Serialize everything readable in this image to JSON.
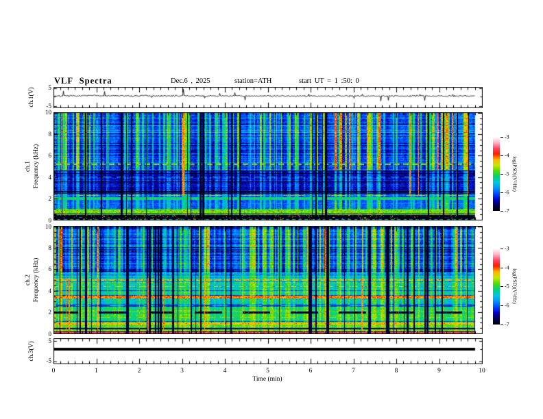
{
  "header": {
    "title": "VLF Spectra",
    "date": "Dec.6 , 2025",
    "station": "station=ATH",
    "start_ut": "start UT =  1 :50: 0"
  },
  "x_axis": {
    "label": "Time (min)",
    "ticks": [
      "0",
      "1",
      "2",
      "3",
      "4",
      "5",
      "6",
      "7",
      "8",
      "9",
      "10"
    ],
    "range_min": [
      0,
      10
    ],
    "minor_tick_step_min": 0.1667
  },
  "panels": {
    "ch1_wave": {
      "ylabel": "ch.1(V)",
      "ytick_top": "5",
      "ytick_bottom": "-5"
    },
    "ch1_spec": {
      "ylabel_line1": "ch.1",
      "ylabel_line2": "Frequency (kHz)",
      "yticks": [
        "10",
        "8",
        "6",
        "4",
        "2",
        "0"
      ]
    },
    "ch2_spec": {
      "ylabel_line1": "ch.2",
      "ylabel_line2": "Frequency (kHz)",
      "yticks": [
        "10",
        "8",
        "6",
        "4",
        "2",
        "0"
      ]
    },
    "ch3_wave": {
      "ylabel": "ch.3(V)",
      "ytick_top": "5",
      "ytick_bottom": "-5"
    }
  },
  "colorbar": {
    "label": "log(PSD)(V²/Hz)",
    "ticks": [
      "-3",
      "-4",
      "-5",
      "-6",
      "-7"
    ],
    "value_range": [
      -7,
      -3
    ],
    "gradient_top_to_bottom": [
      "#ffffff",
      "#ffb4c8",
      "#ff4664",
      "#ff1e00",
      "#ffb400",
      "#c8e600",
      "#50dc00",
      "#00d278",
      "#00c8dc",
      "#0096ff",
      "#0046ff",
      "#0000c8",
      "#000055",
      "#000000"
    ]
  },
  "colors": {
    "frame": "#000000",
    "background": "#ffffff",
    "waveform": "#000000"
  },
  "chart_data": [
    {
      "id": "ch1_waveform",
      "type": "line",
      "panel": "p1",
      "ylabel": "ch.1(V)",
      "x_range_min": [
        0,
        10
      ],
      "y_range_V": [
        -5,
        5
      ],
      "data_end_min": 9.83,
      "baseline_V": 0.35,
      "noise_std_V": 0.3,
      "spike_rate": 0.047,
      "spike_amp_max_V": 4.6,
      "line_color": "#000000",
      "description": "Noisy near-zero baseline with frequent impulsive spikes up to about ±4.5 V"
    },
    {
      "id": "ch1_spectrogram",
      "type": "heatmap",
      "panel": "p2",
      "x_range_min": [
        0,
        10
      ],
      "y_range_kHz": [
        0,
        10
      ],
      "z_range_logPSD": [
        -7,
        -3
      ],
      "data_end_min": 9.83,
      "regions": [
        {
          "f_lo": 4.7,
          "f_hi": 10,
          "base": -6.3,
          "stripe_gain": 1.0,
          "row_banding": 0.6
        },
        {
          "f_lo": 2.45,
          "f_hi": 4.7,
          "base": -6.55,
          "stripe_gain": 0.5,
          "row_banding": 1.3
        },
        {
          "f_lo": 1.05,
          "f_hi": 2.45,
          "base": -6.1,
          "stripe_gain": 0.55,
          "row_banding": 0.8
        },
        {
          "f_lo": 0.48,
          "f_hi": 1.05,
          "base": -5.0,
          "stripe_gain": 0.25,
          "row_banding": 1.6
        },
        {
          "f_lo": 0,
          "f_hi": 0.48,
          "base": -7,
          "stripe_gain": 0.05,
          "row_banding": 0,
          "speckle": 0.06
        }
      ],
      "h_lines": [
        {
          "f": 5.2,
          "level": -4.7,
          "half_w": 0.05,
          "period": 13,
          "on": 8,
          "dots": true
        },
        {
          "f": 4.0,
          "level": -5.6,
          "half_w": 0.04,
          "period": 20,
          "on": 12
        },
        {
          "f": 2.32,
          "level": -4.5,
          "half_w": 0.05,
          "period": 60,
          "on": 30,
          "dots": true
        },
        {
          "f": 2.02,
          "level": -5.15,
          "half_w": 0.14
        },
        {
          "f": 0.82,
          "level": -4.75,
          "half_w": 0.1,
          "dots": true
        },
        {
          "f": 0.6,
          "level": -6.9,
          "half_w": 0.05
        },
        {
          "f": 0.1,
          "level": -5.3,
          "half_w": 0.04,
          "period": 9,
          "on": 5
        }
      ],
      "v_black_rate": 0.05,
      "v_red_rate": 0.012,
      "red_f_range": [
        2.3,
        10
      ],
      "description": "Dense vertical sferic striping (green/yellow on blue), dark-blue banded zone 2.5-4.7 kHz, green band near 2 kHz, olive band near 0.8 kHz, black band below 0.5 kHz"
    },
    {
      "id": "ch2_spectrogram",
      "type": "heatmap",
      "panel": "p3",
      "x_range_min": [
        0,
        10
      ],
      "y_range_kHz": [
        0,
        10
      ],
      "z_range_logPSD": [
        -7,
        -3
      ],
      "data_end_min": 9.83,
      "regions": [
        {
          "f_lo": 5.7,
          "f_hi": 10,
          "base": -6.25,
          "stripe_gain": 1.05,
          "row_banding": 0.9
        },
        {
          "f_lo": 4.55,
          "f_hi": 5.7,
          "base": -5.65,
          "stripe_gain": 0.5,
          "row_banding": 0.7
        },
        {
          "f_lo": 2.5,
          "f_hi": 4.55,
          "base": -5.55,
          "stripe_gain": 0.5,
          "row_banding": 0.9
        },
        {
          "f_lo": 1.1,
          "f_hi": 2.5,
          "base": -5.25,
          "stripe_gain": 0.35,
          "row_banding": 1.3
        },
        {
          "f_lo": 0.28,
          "f_hi": 1.1,
          "base": -4.95,
          "stripe_gain": 0.25,
          "row_banding": 1.4
        },
        {
          "f_lo": 0,
          "f_hi": 0.28,
          "base": -7,
          "stripe_gain": 0.05,
          "row_banding": 0,
          "speckle": 0.05
        }
      ],
      "h_lines": [
        {
          "f": 5.02,
          "level": -4.35,
          "half_w": 0.06,
          "period": 14,
          "on": 10,
          "dots": true
        },
        {
          "f": 4.4,
          "level": -4.55,
          "half_w": 0.05,
          "period": 18,
          "on": 12,
          "dots": true
        },
        {
          "f": 3.42,
          "level": -4.15,
          "half_w": 0.12,
          "dots": true
        },
        {
          "f": 2.62,
          "level": -6.5,
          "half_w": 0.05,
          "period": 50,
          "on": 28
        },
        {
          "f": 2.0,
          "level": -6.8,
          "half_w": 0.09,
          "period": 70,
          "on": 40,
          "dots": true
        },
        {
          "f": 1.55,
          "level": -4.6,
          "half_w": 0.06,
          "period": 30,
          "on": 20
        },
        {
          "f": 1.0,
          "level": -4.35,
          "half_w": 0.09,
          "dots": true
        },
        {
          "f": 0.5,
          "level": -6.6,
          "half_w": 0.04
        },
        {
          "f": 0.13,
          "level": -3.95,
          "half_w": 0.05
        }
      ],
      "v_black_rate": 0.085,
      "v_red_rate": 0.02,
      "red_f_range": [
        0.3,
        5.2
      ],
      "description": "Greener overall; orange lines near 5 and 4.4 kHz, bright yellow band near 3.4 kHz, dashed dark segments near 2 kHz, yellow band near 1 kHz, red line just above 0 kHz, thin black bottom band"
    },
    {
      "id": "ch3_waveform",
      "type": "line",
      "panel": "p4",
      "ylabel": "ch.3(V)",
      "x_range_min": [
        0,
        10
      ],
      "y_range_V": [
        -5,
        5
      ],
      "data_end_min": 9.83,
      "constant_value_V": 0,
      "line_thickness_px": 4,
      "line_color": "#000000",
      "description": "Flat thick line at 0 V for the whole record"
    }
  ]
}
